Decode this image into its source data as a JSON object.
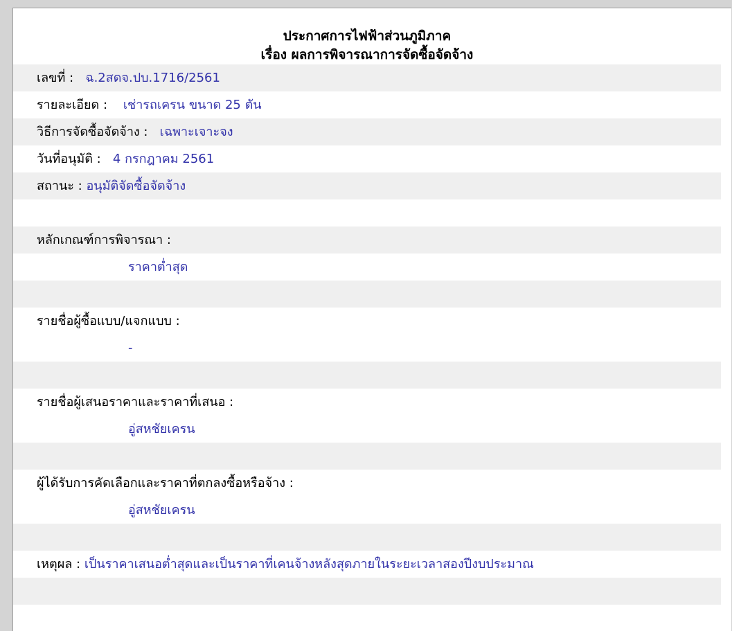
{
  "header": {
    "line1": "ประกาศการไฟฟ้าส่วนภูมิภาค",
    "line2": "เรื่อง ผลการพิจารณาการจัดซื้อจัดจ้าง"
  },
  "fields": {
    "number_label": "เลขที่ :",
    "number_value": "ฉ.2สดจ.ปบ.1716/2561",
    "detail_label": "รายละเอียด :",
    "detail_value": "เช่ารถเครน ขนาด 25 ตัน",
    "method_label": "วิธีการจัดซื้อจัดจ้าง :",
    "method_value": "เฉพาะเจาะจง",
    "date_label": "วันที่อนุมัติ :",
    "date_value": "4 กรกฎาคม 2561",
    "status_label": "สถานะ :",
    "status_value": "อนุมัติจัดซื้อจัดจ้าง",
    "criteria_label": "หลักเกณฑ์การพิจารณา :",
    "criteria_value": "ราคาต่ำสุด",
    "buyers_label": "รายชื่อผู้ซื้อแบบ/แจกแบบ :",
    "buyers_value": "-",
    "bidders_label": "รายชื่อผู้เสนอราคาและราคาที่เสนอ :",
    "bidders_value": "อู่สหชัยเครน",
    "winner_label": "ผู้ได้รับการคัดเลือกและราคาที่ตกลงซื้อหรือจ้าง :",
    "winner_value": "อู่สหชัยเครน",
    "reason_label": "เหตุผล :",
    "reason_value": "เป็นราคาเสนอต่ำสุดและเป็นราคาที่เคนจ้างหลังสุดภายในระยะเวลาสองปีงบประมาณ"
  }
}
